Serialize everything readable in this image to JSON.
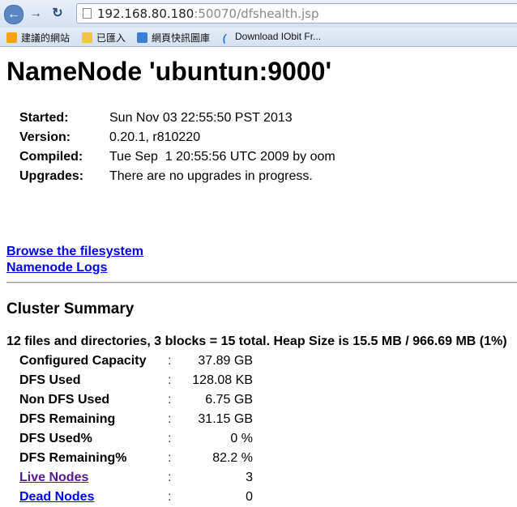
{
  "browser": {
    "url_host": "192.168.80.180",
    "url_rest": ":50070/dfshealth.jsp",
    "bookmarks": [
      {
        "label": "建議的網站",
        "icon": "bookmark-star-icon"
      },
      {
        "label": "已匯入",
        "icon": "folder-icon"
      },
      {
        "label": "網頁快訊圖庫",
        "icon": "web-slice-icon"
      },
      {
        "label": "Download IObit Fr...",
        "icon": "iobit-icon"
      }
    ]
  },
  "page": {
    "title": "NameNode 'ubuntun:9000'",
    "info": [
      {
        "key": "Started:",
        "value": "Sun Nov 03 22:55:50 PST 2013"
      },
      {
        "key": "Version:",
        "value": "0.20.1, r810220"
      },
      {
        "key": "Compiled:",
        "value": "Tue Sep  1 20:55:56 UTC 2009 by oom"
      },
      {
        "key": "Upgrades:",
        "value": "There are no upgrades in progress."
      }
    ],
    "links": {
      "browse": "Browse the filesystem",
      "logs": "Namenode Logs"
    },
    "cluster_title": "Cluster Summary",
    "summary_line": "12 files and directories, 3 blocks = 15 total. Heap Size is 15.5 MB / 966.69 MB (1%)",
    "colon": ":",
    "stats": [
      {
        "key": "Configured Capacity",
        "value": "37.89 GB"
      },
      {
        "key": "DFS Used",
        "value": "128.08 KB"
      },
      {
        "key": "Non DFS Used",
        "value": "6.75 GB"
      },
      {
        "key": "DFS Remaining",
        "value": "31.15 GB"
      },
      {
        "key": "DFS Used%",
        "value": "0 %"
      },
      {
        "key": "DFS Remaining%",
        "value": "82.2 %"
      },
      {
        "key": "Live Nodes",
        "value": "3"
      },
      {
        "key": "Dead Nodes",
        "value": "0"
      }
    ]
  }
}
